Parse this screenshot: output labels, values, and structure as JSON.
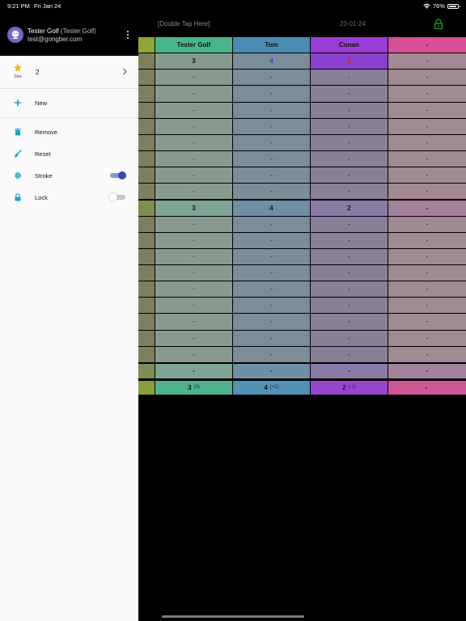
{
  "status_bar": {
    "time": "9:21 PM",
    "date": "Fri Jan 24",
    "battery": "76%"
  },
  "header": {
    "double_tap": "[Double Tap Here]",
    "date": "20-01-24"
  },
  "table": {
    "columns": [
      "Tester Golf",
      "Tom",
      "Conan",
      "-"
    ],
    "rows": [
      [
        "3",
        "4",
        "2",
        "-"
      ],
      [
        "-",
        "-",
        "-",
        "-"
      ],
      [
        "-",
        "-",
        "-",
        "-"
      ],
      [
        "-",
        "-",
        "-",
        "-"
      ],
      [
        "-",
        "-",
        "-",
        "-"
      ],
      [
        "-",
        "-",
        "-",
        "-"
      ],
      [
        "-",
        "-",
        "-",
        "-"
      ],
      [
        "-",
        "-",
        "-",
        "-"
      ],
      [
        "-",
        "-",
        "-",
        "-"
      ],
      [
        "3",
        "4",
        "2",
        "-"
      ],
      [
        "-",
        "-",
        "-",
        "-"
      ],
      [
        "-",
        "-",
        "-",
        "-"
      ],
      [
        "-",
        "-",
        "-",
        "-"
      ],
      [
        "-",
        "-",
        "-",
        "-"
      ],
      [
        "-",
        "-",
        "-",
        "-"
      ],
      [
        "-",
        "-",
        "-",
        "-"
      ],
      [
        "-",
        "-",
        "-",
        "-"
      ],
      [
        "-",
        "-",
        "-",
        "-"
      ],
      [
        "-",
        "-",
        "-",
        "-"
      ],
      [
        "-",
        "-",
        "-",
        "-"
      ]
    ],
    "totals": [
      {
        "value": "3",
        "diff": "(0)"
      },
      {
        "value": "4",
        "diff": "(+1)"
      },
      {
        "value": "2",
        "diff": "(-1)"
      },
      {
        "value": "-",
        "diff": ""
      }
    ]
  },
  "drawer": {
    "user_name": "Tester Golf",
    "user_name_paren": "(Tester Golf)",
    "user_email": "test@gongber.com",
    "star_caption": "Star",
    "star_value": "2",
    "new_label": "New",
    "remove_label": "Remove",
    "reset_label": "Reset",
    "stroke_label": "Stroke",
    "lock_label": "Lock",
    "stroke_on": true,
    "lock_on": false
  },
  "colors": {
    "accent": "#3949ab",
    "menu_icon": "#1fa3c7",
    "star": "#f2b705",
    "lock_green": "#1faa2b"
  }
}
